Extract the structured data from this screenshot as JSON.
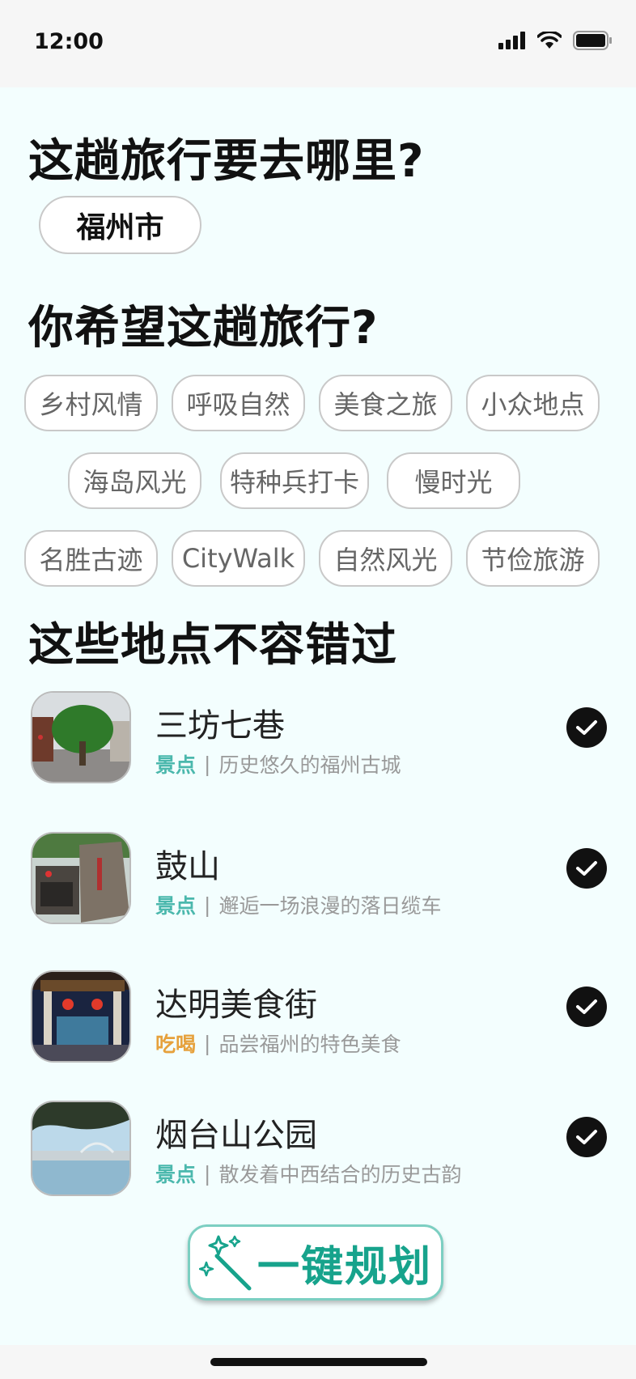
{
  "status": {
    "time": "12:00"
  },
  "section1": {
    "title": "这趟旅行要去哪里?",
    "city": "福州市"
  },
  "section2": {
    "title": "你希望这趟旅行?",
    "tags_row1": [
      "乡村风情",
      "呼吸自然",
      "美食之旅",
      "小众地点"
    ],
    "tags_row2": [
      "海岛风光",
      "特种兵打卡",
      "慢时光"
    ],
    "tags_row3": [
      "名胜古迹",
      "CityWalk",
      "自然风光",
      "节俭旅游"
    ]
  },
  "section3": {
    "title": "这些地点不容错过",
    "places": [
      {
        "name": "三坊七巷",
        "category": "景点",
        "desc": "历史悠久的福州古城",
        "checked": true
      },
      {
        "name": "鼓山",
        "category": "景点",
        "desc": "邂逅一场浪漫的落日缆车",
        "checked": true
      },
      {
        "name": "达明美食街",
        "category": "吃喝",
        "desc": "品尝福州的特色美食",
        "checked": true
      },
      {
        "name": "烟台山公园",
        "category": "景点",
        "desc": "散发着中西结合的历史古韵",
        "checked": true
      }
    ]
  },
  "action": {
    "label": "一键规划"
  },
  "colors": {
    "background": "#f3fefe",
    "scenic_category": "#4bb8ad",
    "food_category": "#e6a13c",
    "accent": "#17a38c"
  },
  "icons": {
    "signal": "signal-icon",
    "wifi": "wifi-icon",
    "battery": "battery-icon",
    "check": "check-icon",
    "magic_wand": "magic-wand-icon"
  }
}
